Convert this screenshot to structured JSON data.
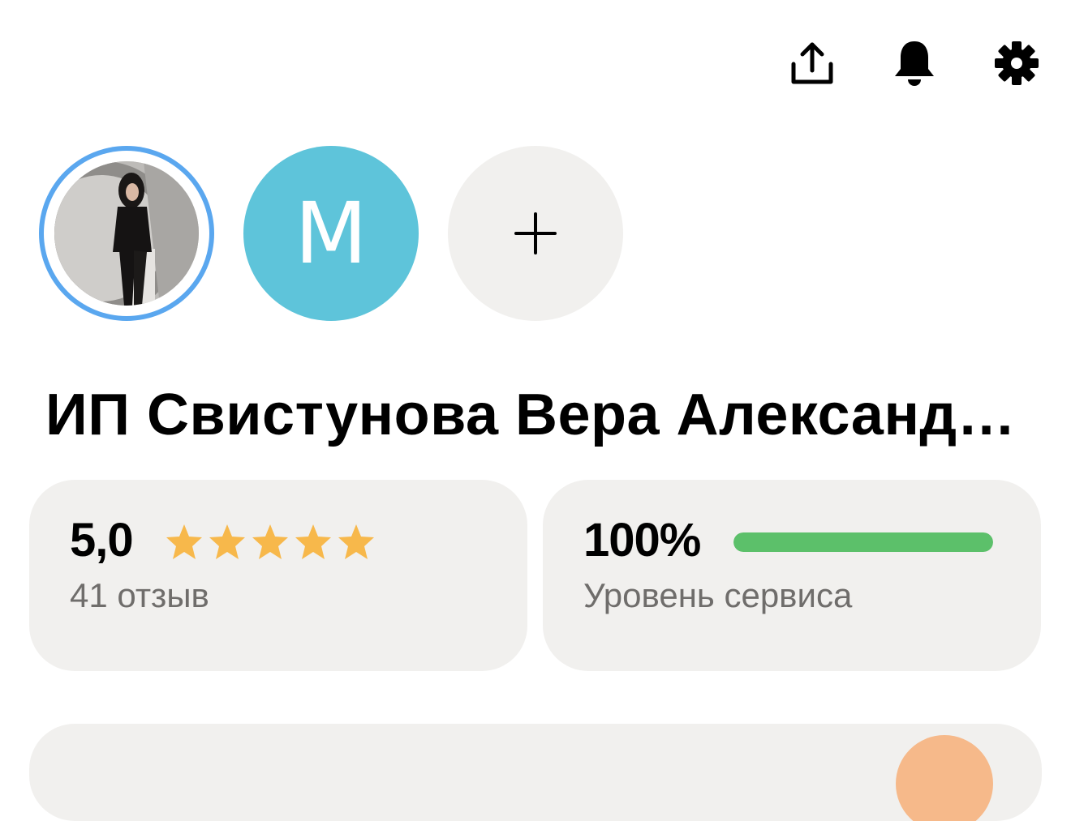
{
  "top_icons": [
    "share-icon",
    "bell-icon",
    "gear-icon"
  ],
  "avatars": {
    "active_ring_color": "#5aa7ef",
    "letter_avatar": {
      "letter": "M",
      "color": "#5ec4da"
    },
    "add_button": {
      "symbol": "+"
    }
  },
  "profile": {
    "name": "ИП Свистунова Вера Александровна"
  },
  "rating_card": {
    "value": "5,0",
    "stars_filled": 5,
    "stars_total": 5,
    "reviews": "41 отзыв",
    "star_color": "#f7b84b"
  },
  "service_card": {
    "value": "100%",
    "progress": 1.0,
    "label": "Уровень сервиса",
    "bar_color": "#5cc06a"
  }
}
